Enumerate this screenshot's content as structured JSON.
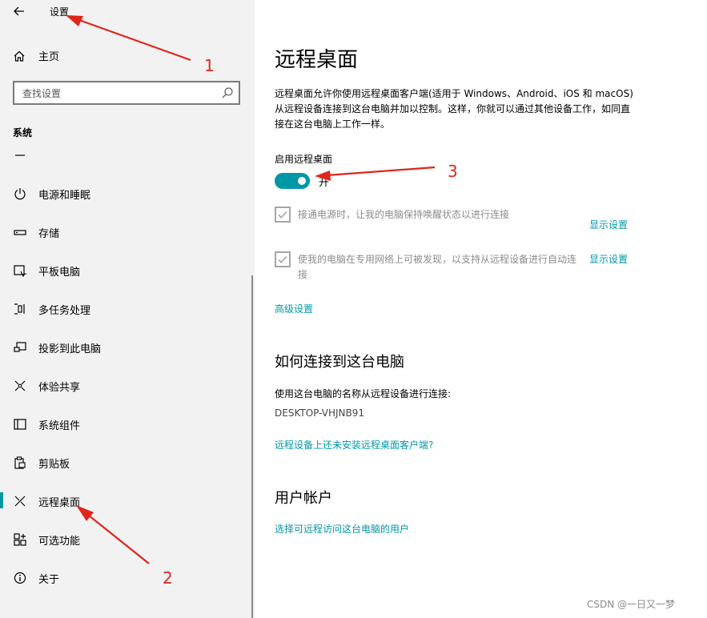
{
  "app": {
    "title": "设置"
  },
  "sidebar": {
    "home_label": "主页",
    "search": {
      "placeholder": "查找设置"
    },
    "section_label": "系统",
    "items": [
      {
        "label": "电源和睡眠",
        "icon": "power-icon"
      },
      {
        "label": "存储",
        "icon": "storage-icon"
      },
      {
        "label": "平板电脑",
        "icon": "tablet-icon"
      },
      {
        "label": "多任务处理",
        "icon": "multitask-icon"
      },
      {
        "label": "投影到此电脑",
        "icon": "project-icon"
      },
      {
        "label": "体验共享",
        "icon": "share-icon"
      },
      {
        "label": "系统组件",
        "icon": "components-icon"
      },
      {
        "label": "剪贴板",
        "icon": "clipboard-icon"
      },
      {
        "label": "远程桌面",
        "icon": "remote-desktop-icon",
        "active": true
      },
      {
        "label": "可选功能",
        "icon": "optional-features-icon"
      },
      {
        "label": "关于",
        "icon": "info-icon"
      }
    ]
  },
  "main": {
    "title": "远程桌面",
    "description": "远程桌面允许你使用远程桌面客户端(适用于 Windows、Android、iOS 和 macOS)从远程设备连接到这台电脑并加以控制。这样，你就可以通过其他设备工作，如同直接在这台电脑上工作一样。",
    "enable_label": "启用远程桌面",
    "toggle_state": "开",
    "toggle_on": true,
    "option1": {
      "text": "接通电源时，让我的电脑保持唤醒状态以进行连接",
      "checked": true,
      "link": "显示设置"
    },
    "option2": {
      "text": "使我的电脑在专用网络上可被发现，以支持从远程设备进行自动连接",
      "checked": true,
      "link": "显示设置"
    },
    "advanced_link": "高级设置",
    "how_to_heading": "如何连接到这台电脑",
    "how_to_text": "使用这台电脑的名称从远程设备进行连接:",
    "pc_name": "DESKTOP-VHJNB91",
    "client_link": "远程设备上还未安装远程桌面客户端?",
    "accounts_heading": "用户帐户",
    "accounts_link": "选择可远程访问这台电脑的用户"
  },
  "annotations": {
    "label1": "1",
    "label2": "2",
    "label3": "3",
    "color": "#e0251b"
  },
  "watermark": "CSDN @一日又一梦",
  "colors": {
    "accent": "#0097a7",
    "sidebar_bg": "#f2f2f2"
  }
}
